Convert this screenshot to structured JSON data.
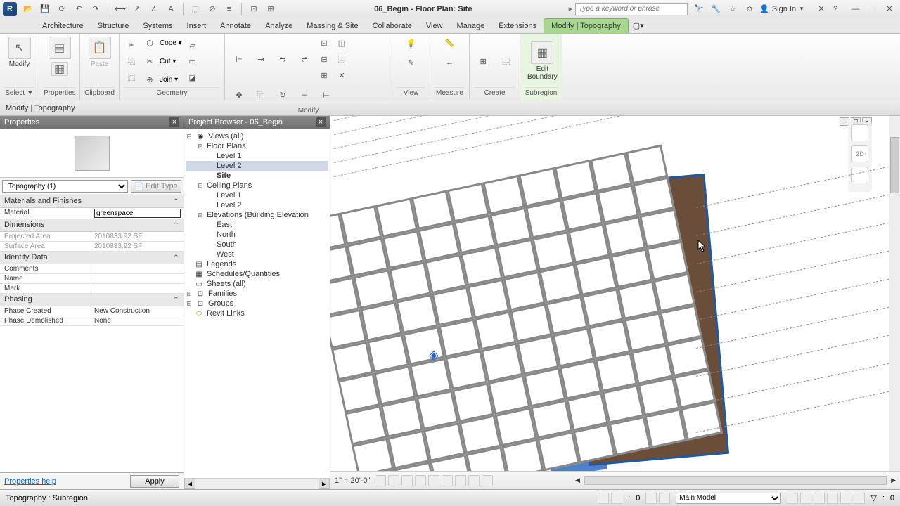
{
  "app": {
    "title": "06_Begin - Floor Plan: Site",
    "search_placeholder": "Type a keyword or phrase",
    "signin": "Sign In"
  },
  "tabs": {
    "items": [
      "Architecture",
      "Structure",
      "Systems",
      "Insert",
      "Annotate",
      "Analyze",
      "Massing & Site",
      "Collaborate",
      "View",
      "Manage",
      "Extensions",
      "Modify | Topography"
    ],
    "active": 11
  },
  "ribbon": {
    "select": {
      "modify": "Modify",
      "label": "Select ▼"
    },
    "properties": {
      "btn": "Properties",
      "label": "Properties"
    },
    "clipboard": {
      "paste": "Paste",
      "label": "Clipboard"
    },
    "geometry": {
      "cope": "Cope ▾",
      "cut": "Cut ▾",
      "join": "Join ▾",
      "label": "Geometry"
    },
    "modify": {
      "label": "Modify"
    },
    "view": {
      "label": "View"
    },
    "measure": {
      "label": "Measure"
    },
    "create": {
      "label": "Create"
    },
    "subregion": {
      "edit": "Edit\nBoundary",
      "label": "Subregion"
    }
  },
  "optbar": {
    "text": "Modify | Topography"
  },
  "properties": {
    "title": "Properties",
    "type_select": "Topography (1)",
    "edit_type": "Edit Type",
    "cats": {
      "mat": "Materials and Finishes",
      "dim": "Dimensions",
      "id": "Identity Data",
      "phase": "Phasing"
    },
    "rows": {
      "material_lbl": "Material",
      "material_val": "greenspace",
      "projarea_lbl": "Projected Area",
      "projarea_val": "2010833.92 SF",
      "surfarea_lbl": "Surface Area",
      "surfarea_val": "2010833.92 SF",
      "comments_lbl": "Comments",
      "comments_val": "",
      "name_lbl": "Name",
      "name_val": "",
      "mark_lbl": "Mark",
      "mark_val": "",
      "phasecreated_lbl": "Phase Created",
      "phasecreated_val": "New Construction",
      "phasedemolished_lbl": "Phase Demolished",
      "phasedemolished_val": "None"
    },
    "help": "Properties help",
    "apply": "Apply"
  },
  "browser": {
    "title": "Project Browser - 06_Begin",
    "views": "Views (all)",
    "floorplans": "Floor Plans",
    "level1": "Level 1",
    "level2": "Level 2",
    "site": "Site",
    "ceilingplans": "Ceiling Plans",
    "clevel1": "Level 1",
    "clevel2": "Level 2",
    "elevations": "Elevations (Building Elevation",
    "east": "East",
    "north": "North",
    "south": "South",
    "west": "West",
    "legends": "Legends",
    "schedules": "Schedules/Quantities",
    "sheets": "Sheets (all)",
    "families": "Families",
    "groups": "Groups",
    "revitlinks": "Revit Links"
  },
  "canvas": {
    "scale": "1\" = 20'-0\""
  },
  "statusbar": {
    "text": "Topography : Subregion",
    "mainmodel": "Main Model",
    "zero": "0"
  }
}
